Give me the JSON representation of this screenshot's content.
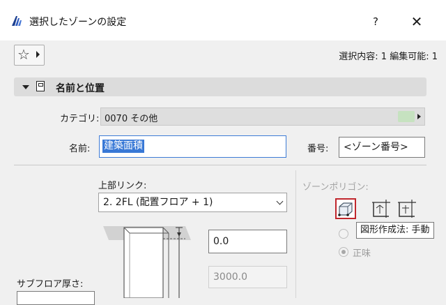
{
  "window": {
    "title": "選択したゾーンの設定",
    "help_label": "?",
    "close_label": "✕"
  },
  "toolbar": {
    "favorites_icon": "star-icon",
    "selection_info": "選択内容: 1 編集可能: 1"
  },
  "section": {
    "title": "名前と位置"
  },
  "category": {
    "label": "カテゴリ:",
    "value": "0070  その他",
    "swatch_color": "#c6e2c0"
  },
  "name": {
    "label": "名前:",
    "value": "建築面積"
  },
  "number": {
    "label": "番号:",
    "value": "<ゾーン番号>"
  },
  "upper_link": {
    "label": "上部リンク:",
    "value": "2. 2FL (配置フロア + 1)"
  },
  "offset_value": "0.0",
  "height_value": "3000.0",
  "subfloor": {
    "label": "サブフロア厚さ:"
  },
  "zone_polygon": {
    "label": "ゾーンポリゴン:",
    "tooltip": "図形作成法: 手動",
    "radio_net_label": "正味"
  }
}
